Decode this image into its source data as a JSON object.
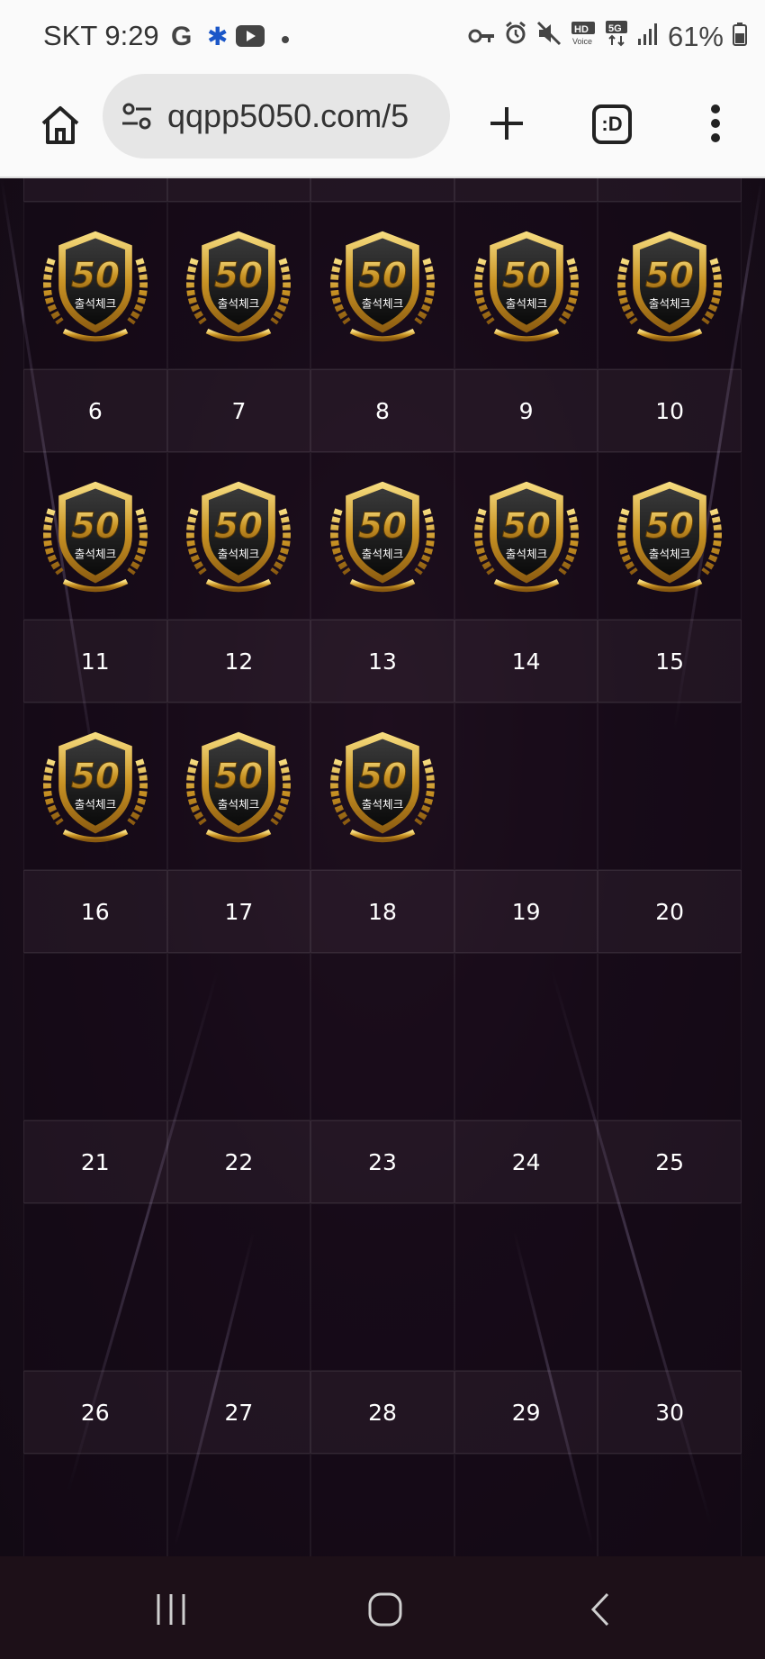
{
  "status_bar": {
    "carrier_time": "SKT 9:29",
    "battery": "61%",
    "left_icons": [
      "google-icon",
      "bluetooth-icon",
      "youtube-icon",
      "dot-icon"
    ],
    "right_icons": [
      "key-icon",
      "alarm-icon",
      "mute-icon",
      "hd-voice-icon",
      "5g-icon",
      "signal-icon",
      "battery-icon"
    ]
  },
  "browser": {
    "url": "qqpp5050.com/5",
    "tab_icon_label": ":D"
  },
  "calendar": {
    "badge_text": "50",
    "badge_subtext": "출석체크",
    "weeks": [
      {
        "days": [
          "",
          "",
          "",
          "",
          ""
        ],
        "checked": [
          true,
          true,
          true,
          true,
          true
        ]
      },
      {
        "days": [
          "6",
          "7",
          "8",
          "9",
          "10"
        ],
        "checked": [
          true,
          true,
          true,
          true,
          true
        ]
      },
      {
        "days": [
          "11",
          "12",
          "13",
          "14",
          "15"
        ],
        "checked": [
          true,
          true,
          true,
          false,
          false
        ]
      },
      {
        "days": [
          "16",
          "17",
          "18",
          "19",
          "20"
        ],
        "checked": [
          false,
          false,
          false,
          false,
          false
        ]
      },
      {
        "days": [
          "21",
          "22",
          "23",
          "24",
          "25"
        ],
        "checked": [
          false,
          false,
          false,
          false,
          false
        ]
      },
      {
        "days": [
          "26",
          "27",
          "28",
          "29",
          "30"
        ],
        "checked": [
          false,
          false,
          false,
          false,
          false
        ]
      }
    ]
  },
  "colors": {
    "scroll_top_button": "#6c1bb3",
    "badge_gold": "#d6a531",
    "page_background": "#1b0e1c"
  }
}
